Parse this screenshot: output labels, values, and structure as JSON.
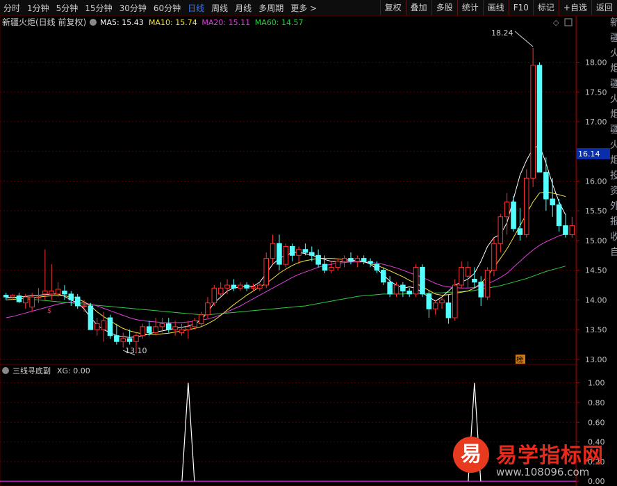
{
  "toolbar": {
    "periods": [
      "分时",
      "1分钟",
      "5分钟",
      "15分钟",
      "30分钟",
      "60分钟",
      "日线",
      "周线",
      "月线",
      "多周期",
      "更多 >"
    ],
    "active_period": "日线",
    "actions": [
      "复权",
      "叠加",
      "多股",
      "统计",
      "画线",
      "F10",
      "标记",
      "+自选",
      "返回"
    ]
  },
  "main_panel": {
    "title": "新疆火炬(日线 前复权)",
    "ma_labels": [
      {
        "name": "MA5",
        "value": "15.43",
        "color": "#ffffff"
      },
      {
        "name": "MA10",
        "value": "15.74",
        "color": "#f2e43c"
      },
      {
        "name": "MA20",
        "value": "15.11",
        "color": "#e040e0"
      },
      {
        "name": "MA60",
        "value": "14.57",
        "color": "#2ecc40"
      }
    ],
    "high_label": "18.24",
    "low_label": "13.10",
    "price_tag": "16.14",
    "badge": "榜",
    "dollar_mark": "$"
  },
  "sub_panel": {
    "title": "三线寻底副",
    "xg_label": "XG: 0.00"
  },
  "side_strip": [
    "新",
    "疆",
    "火",
    "炬",
    "疆",
    "火",
    "炬",
    "疆",
    "火",
    "炬",
    "投",
    "资",
    "外",
    "报",
    "收",
    "自"
  ],
  "watermark": {
    "logo": "易",
    "name": "易学指标网",
    "url": "www.108096.com"
  },
  "colors": {
    "up": "#ff3232",
    "down": "#54ffff",
    "grid": "#5a0000",
    "axis": "#c0c0c0"
  },
  "chart_data": [
    {
      "type": "candlestick",
      "title": "新疆火炬(日线 前复权)",
      "y_ticks": [
        13.0,
        13.5,
        14.0,
        14.5,
        15.0,
        15.5,
        16.0,
        16.5,
        17.0,
        17.5,
        18.0
      ],
      "ylim": [
        12.94,
        18.58
      ],
      "candles": [
        [
          14.08,
          14.12,
          14.0,
          14.05
        ],
        [
          14.05,
          14.1,
          14.0,
          14.08
        ],
        [
          14.07,
          14.12,
          13.95,
          13.97
        ],
        [
          13.95,
          14.1,
          13.85,
          14.05
        ],
        [
          13.88,
          14.12,
          13.8,
          14.05
        ],
        [
          14.05,
          14.2,
          13.95,
          14.05
        ],
        [
          14.1,
          14.85,
          14.0,
          14.15
        ],
        [
          14.1,
          14.6,
          14.0,
          14.15
        ],
        [
          14.1,
          14.3,
          14.05,
          14.18
        ],
        [
          14.15,
          14.25,
          14.0,
          14.1
        ],
        [
          14.1,
          14.15,
          13.9,
          14.0
        ],
        [
          14.05,
          14.1,
          13.85,
          13.9
        ],
        [
          13.9,
          14.0,
          13.8,
          13.9
        ],
        [
          13.9,
          13.95,
          13.5,
          13.5
        ],
        [
          13.5,
          13.7,
          13.4,
          13.6
        ],
        [
          13.5,
          13.8,
          13.3,
          13.65
        ],
        [
          13.7,
          13.75,
          13.35,
          13.4
        ],
        [
          13.4,
          13.6,
          13.25,
          13.3
        ],
        [
          13.3,
          13.45,
          13.2,
          13.35
        ],
        [
          13.35,
          13.5,
          13.25,
          13.3
        ],
        [
          13.3,
          13.45,
          13.1,
          13.4
        ],
        [
          13.4,
          13.6,
          13.35,
          13.55
        ],
        [
          13.55,
          13.65,
          13.4,
          13.45
        ],
        [
          13.45,
          13.7,
          13.4,
          13.55
        ],
        [
          13.55,
          13.7,
          13.45,
          13.6
        ],
        [
          13.6,
          13.7,
          13.45,
          13.5
        ],
        [
          13.5,
          13.65,
          13.4,
          13.55
        ],
        [
          13.45,
          13.6,
          13.4,
          13.5
        ],
        [
          13.5,
          13.65,
          13.35,
          13.55
        ],
        [
          13.55,
          13.7,
          13.5,
          13.65
        ],
        [
          13.6,
          13.8,
          13.55,
          13.75
        ],
        [
          13.75,
          14.05,
          13.7,
          13.95
        ],
        [
          13.95,
          14.25,
          13.9,
          14.2
        ],
        [
          14.1,
          14.3,
          14.05,
          14.2
        ],
        [
          14.2,
          14.35,
          14.1,
          14.25
        ],
        [
          14.25,
          14.35,
          14.15,
          14.2
        ],
        [
          14.2,
          14.3,
          14.15,
          14.25
        ],
        [
          14.25,
          14.3,
          14.15,
          14.2
        ],
        [
          14.2,
          14.28,
          14.15,
          14.22
        ],
        [
          14.2,
          14.28,
          14.15,
          14.25
        ],
        [
          14.25,
          14.8,
          14.2,
          14.7
        ],
        [
          14.7,
          15.1,
          14.6,
          14.95
        ],
        [
          14.95,
          15.1,
          14.5,
          14.6
        ],
        [
          14.6,
          14.95,
          14.55,
          14.9
        ],
        [
          14.9,
          14.95,
          14.65,
          14.75
        ],
        [
          14.75,
          14.9,
          14.6,
          14.85
        ],
        [
          14.85,
          14.95,
          14.75,
          14.8
        ],
        [
          14.8,
          14.9,
          14.65,
          14.75
        ],
        [
          14.75,
          14.85,
          14.55,
          14.6
        ],
        [
          14.6,
          14.75,
          14.45,
          14.5
        ],
        [
          14.5,
          14.65,
          14.45,
          14.55
        ],
        [
          14.55,
          14.7,
          14.5,
          14.65
        ],
        [
          14.65,
          14.75,
          14.55,
          14.7
        ],
        [
          14.7,
          14.8,
          14.6,
          14.65
        ],
        [
          14.65,
          14.75,
          14.55,
          14.7
        ],
        [
          14.7,
          14.75,
          14.6,
          14.65
        ],
        [
          14.65,
          14.7,
          14.55,
          14.62
        ],
        [
          14.6,
          14.65,
          14.45,
          14.5
        ],
        [
          14.5,
          14.55,
          14.25,
          14.3
        ],
        [
          14.3,
          14.4,
          14.05,
          14.1
        ],
        [
          14.1,
          14.3,
          14.05,
          14.25
        ],
        [
          14.25,
          14.3,
          14.05,
          14.15
        ],
        [
          14.15,
          14.2,
          14.05,
          14.1
        ],
        [
          14.1,
          14.6,
          14.05,
          14.55
        ],
        [
          14.55,
          14.6,
          14.05,
          14.1
        ],
        [
          14.1,
          14.15,
          13.7,
          13.85
        ],
        [
          13.85,
          14.0,
          13.75,
          13.95
        ],
        [
          13.95,
          14.05,
          13.85,
          14.0
        ],
        [
          13.95,
          14.1,
          13.6,
          13.7
        ],
        [
          13.7,
          14.35,
          13.65,
          14.25
        ],
        [
          14.25,
          14.65,
          14.2,
          14.55
        ],
        [
          14.4,
          14.65,
          14.2,
          14.55
        ],
        [
          14.35,
          14.55,
          14.2,
          14.3
        ],
        [
          14.3,
          14.4,
          13.9,
          14.05
        ],
        [
          14.05,
          14.55,
          14.0,
          14.5
        ],
        [
          14.5,
          15.05,
          14.4,
          14.95
        ],
        [
          14.95,
          15.45,
          14.8,
          15.4
        ],
        [
          15.4,
          15.8,
          15.1,
          15.65
        ],
        [
          15.65,
          15.75,
          15.15,
          15.2
        ],
        [
          15.2,
          15.55,
          15.0,
          15.1
        ],
        [
          15.1,
          16.2,
          15.05,
          16.05
        ],
        [
          16.05,
          18.24,
          15.9,
          17.95
        ],
        [
          17.95,
          18.0,
          16.3,
          16.15
        ],
        [
          16.15,
          16.4,
          15.5,
          15.7
        ],
        [
          15.7,
          16.05,
          15.4,
          15.6
        ],
        [
          15.6,
          15.7,
          15.15,
          15.25
        ],
        [
          15.25,
          15.45,
          15.05,
          15.1
        ],
        [
          15.1,
          15.4,
          15.05,
          15.25
        ]
      ],
      "ma5": [
        14.03,
        14.04,
        14.05,
        14.06,
        14.07,
        14.08,
        14.09,
        14.1,
        14.1,
        14.06,
        14.0,
        13.95,
        13.85,
        13.7,
        13.58,
        13.5,
        13.45,
        13.4,
        13.38,
        13.37,
        13.38,
        13.4,
        13.43,
        13.46,
        13.48,
        13.5,
        13.52,
        13.54,
        13.56,
        13.6,
        13.66,
        13.8,
        13.95,
        14.05,
        14.15,
        14.2,
        14.22,
        14.23,
        14.23,
        14.3,
        14.45,
        14.6,
        14.7,
        14.75,
        14.8,
        14.8,
        14.78,
        14.75,
        14.72,
        14.68,
        14.65,
        14.64,
        14.65,
        14.66,
        14.66,
        14.65,
        14.6,
        14.52,
        14.42,
        14.32,
        14.25,
        14.2,
        14.22,
        14.2,
        14.12,
        14.05,
        13.98,
        14.05,
        14.15,
        14.25,
        14.3,
        14.35,
        14.45,
        14.65,
        14.9,
        15.05,
        15.1,
        15.3,
        15.7,
        16.1,
        16.35,
        16.55,
        16.6,
        16.3,
        15.95,
        15.65,
        15.43
      ],
      "ma10": [
        14.0,
        14.01,
        14.02,
        14.03,
        14.04,
        14.05,
        14.06,
        14.07,
        14.08,
        14.07,
        14.05,
        14.02,
        13.97,
        13.9,
        13.8,
        13.72,
        13.65,
        13.58,
        13.52,
        13.48,
        13.45,
        13.43,
        13.42,
        13.42,
        13.43,
        13.44,
        13.46,
        13.48,
        13.5,
        13.52,
        13.55,
        13.6,
        13.66,
        13.74,
        13.83,
        13.92,
        14.0,
        14.08,
        14.15,
        14.22,
        14.28,
        14.36,
        14.45,
        14.52,
        14.58,
        14.63,
        14.66,
        14.68,
        14.7,
        14.7,
        14.7,
        14.69,
        14.68,
        14.67,
        14.66,
        14.64,
        14.61,
        14.58,
        14.54,
        14.49,
        14.44,
        14.39,
        14.33,
        14.28,
        14.22,
        14.16,
        14.1,
        14.08,
        14.09,
        14.11,
        14.13,
        14.15,
        14.2,
        14.28,
        14.4,
        14.55,
        14.7,
        14.86,
        15.05,
        15.25,
        15.45,
        15.65,
        15.8,
        15.82,
        15.8,
        15.77,
        15.74
      ],
      "ma20": [
        13.7,
        13.72,
        13.75,
        13.78,
        13.81,
        13.84,
        13.87,
        13.9,
        13.93,
        13.95,
        13.96,
        13.96,
        13.95,
        13.93,
        13.9,
        13.86,
        13.82,
        13.78,
        13.74,
        13.7,
        13.67,
        13.65,
        13.64,
        13.63,
        13.62,
        13.62,
        13.62,
        13.62,
        13.63,
        13.64,
        13.66,
        13.68,
        13.71,
        13.75,
        13.8,
        13.85,
        13.9,
        13.96,
        14.02,
        14.08,
        14.14,
        14.2,
        14.26,
        14.32,
        14.38,
        14.43,
        14.47,
        14.51,
        14.55,
        14.58,
        14.6,
        14.62,
        14.63,
        14.64,
        14.64,
        14.64,
        14.63,
        14.62,
        14.6,
        14.57,
        14.54,
        14.5,
        14.46,
        14.42,
        14.38,
        14.33,
        14.28,
        14.24,
        14.22,
        14.21,
        14.2,
        14.2,
        14.21,
        14.23,
        14.27,
        14.32,
        14.38,
        14.45,
        14.55,
        14.65,
        14.75,
        14.84,
        14.92,
        14.98,
        15.03,
        15.08,
        15.11
      ],
      "ma60": [
        14.05,
        14.04,
        14.03,
        14.02,
        14.01,
        14.0,
        13.99,
        13.98,
        13.97,
        13.96,
        13.95,
        13.94,
        13.93,
        13.92,
        13.91,
        13.9,
        13.89,
        13.88,
        13.87,
        13.86,
        13.85,
        13.84,
        13.83,
        13.82,
        13.81,
        13.8,
        13.79,
        13.78,
        13.77,
        13.76,
        13.75,
        13.75,
        13.76,
        13.77,
        13.78,
        13.79,
        13.8,
        13.81,
        13.82,
        13.83,
        13.84,
        13.85,
        13.86,
        13.87,
        13.88,
        13.89,
        13.9,
        13.92,
        13.94,
        13.96,
        13.98,
        14.0,
        14.02,
        14.04,
        14.06,
        14.07,
        14.08,
        14.09,
        14.1,
        14.1,
        14.1,
        14.1,
        14.11,
        14.11,
        14.11,
        14.11,
        14.12,
        14.12,
        14.13,
        14.13,
        14.14,
        14.15,
        14.16,
        14.18,
        14.2,
        14.22,
        14.24,
        14.27,
        14.3,
        14.33,
        14.36,
        14.4,
        14.44,
        14.48,
        14.51,
        14.54,
        14.57
      ]
    },
    {
      "type": "line",
      "title": "三线寻底副",
      "y_ticks": [
        0.0,
        0.2,
        0.4,
        0.6,
        0.8,
        1.0
      ],
      "ylim": [
        -0.02,
        1.04
      ],
      "xg": [
        0,
        0,
        0,
        0,
        0,
        0,
        0,
        0,
        0,
        0,
        0,
        0,
        0,
        0,
        0,
        0,
        0,
        0,
        0,
        0,
        0,
        0,
        0,
        0,
        0,
        0,
        0,
        0,
        0,
        0,
        0,
        0,
        0,
        0,
        0,
        0,
        0,
        0,
        0,
        0,
        0,
        0,
        0,
        0,
        0,
        0,
        0,
        0,
        0,
        0,
        0,
        0,
        0,
        0,
        0,
        0,
        0,
        0,
        0,
        0,
        0,
        0,
        0,
        0,
        0,
        0,
        0,
        0,
        0,
        0,
        0,
        0,
        0,
        0,
        0,
        0,
        0,
        0,
        0,
        0,
        0,
        0,
        0,
        0,
        0,
        0,
        0
      ],
      "signal_points": [
        {
          "x": 28,
          "y": 1.0
        },
        {
          "x": 72,
          "y": 1.0
        }
      ]
    }
  ]
}
